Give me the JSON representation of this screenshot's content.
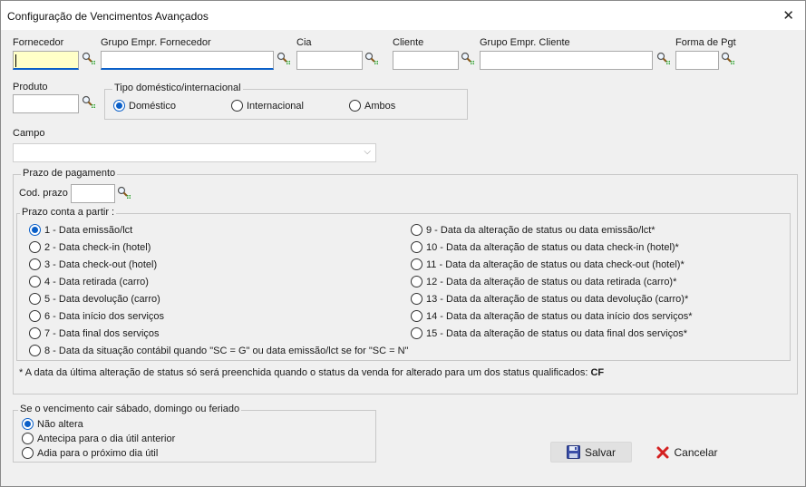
{
  "window": {
    "title": "Configuração de Vencimentos Avançados",
    "close_icon": "close-icon"
  },
  "fields": {
    "fornecedor": "Fornecedor",
    "grupo_fornecedor": "Grupo Empr. Fornecedor",
    "cia": "Cia",
    "cliente": "Cliente",
    "grupo_cliente": "Grupo Empr. Cliente",
    "forma_pgt": "Forma de Pgt",
    "produto": "Produto",
    "campo": "Campo",
    "cod_prazo": "Cod. prazo"
  },
  "tipo": {
    "legend": "Tipo doméstico/internacional",
    "options": [
      "Doméstico",
      "Internacional",
      "Ambos"
    ],
    "selected": 0
  },
  "prazo_pagamento": {
    "legend": "Prazo de pagamento"
  },
  "prazo_conta": {
    "legend": "Prazo conta a partir :",
    "left": [
      "1 - Data emissão/lct",
      "2 - Data check-in (hotel)",
      "3 - Data check-out (hotel)",
      "4 - Data retirada (carro)",
      "5 - Data devolução (carro)",
      "6 - Data início dos serviços",
      "7 - Data final dos serviços",
      "8 - Data da situação contábil quando \"SC = G\" ou data emissão/lct se for \"SC = N\""
    ],
    "right": [
      "9 - Data da alteração de status ou data emissão/lct*",
      "10 - Data da alteração de status ou data check-in (hotel)*",
      "11 - Data da alteração de status ou data check-out (hotel)*",
      "12 - Data da alteração de status ou data retirada (carro)*",
      "13 - Data da alteração de status ou data devolução (carro)*",
      "14 - Data da alteração de status ou data início dos serviços*",
      "15 - Data da alteração de status ou data final dos serviços*"
    ],
    "selected": "1 - Data emissão/lct"
  },
  "note": {
    "text": "* A data da última alteração de status só será preenchida quando o status da venda for alterado para um dos status qualificados:",
    "code": "CF"
  },
  "weekend": {
    "legend": "Se o vencimento cair sábado, domingo ou feriado",
    "options": [
      "Não altera",
      "Antecipa para o dia útil anterior",
      "Adia para o próximo dia útil"
    ],
    "selected": 0
  },
  "buttons": {
    "save": "Salvar",
    "cancel": "Cancelar"
  },
  "colors": {
    "accent": "#0a5fc8",
    "active_field": "#ffffc8",
    "cancel_icon": "#d42020"
  }
}
